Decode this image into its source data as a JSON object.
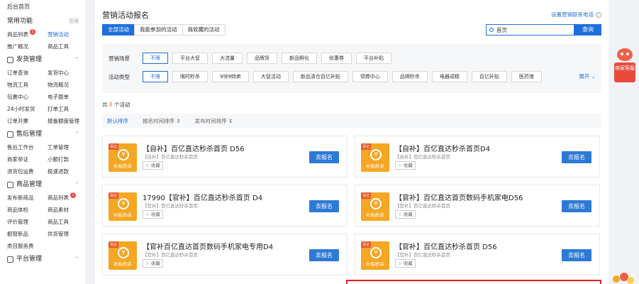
{
  "sidebar": {
    "top_link": "后台首页",
    "sections": [
      {
        "title": "常用功能",
        "right": "管理",
        "items": [
          {
            "label": "商品列表",
            "badge": "1"
          },
          {
            "label": "营销活动",
            "active": true
          },
          {
            "label": "推广概况"
          },
          {
            "label": "商品工具"
          }
        ]
      },
      {
        "title": "发货管理",
        "right": "^",
        "items": [
          {
            "label": "订单查询"
          },
          {
            "label": "发货中心"
          },
          {
            "label": "物流工具"
          },
          {
            "label": "物流概况"
          },
          {
            "label": "包裹中心"
          },
          {
            "label": "电子面单"
          },
          {
            "label": "24小时发货"
          },
          {
            "label": "打单工具"
          },
          {
            "label": "订单开票"
          },
          {
            "label": "报备额度管理"
          }
        ]
      },
      {
        "title": "售后管理",
        "right": "^",
        "items": [
          {
            "label": "售后工作台"
          },
          {
            "label": "工单管理"
          },
          {
            "label": "商家举证"
          },
          {
            "label": "小额打款"
          },
          {
            "label": "退货包运费"
          },
          {
            "label": "极速退款"
          }
        ]
      },
      {
        "title": "商品管理",
        "right": "^",
        "items": [
          {
            "label": "发布新商品"
          },
          {
            "label": "商品列表",
            "badge": "1"
          },
          {
            "label": "商品体检"
          },
          {
            "label": "商品素材"
          },
          {
            "label": "评价管理"
          },
          {
            "label": "商品工具"
          },
          {
            "label": "橱窗新品"
          },
          {
            "label": "供货管理"
          },
          {
            "label": "类目服务费"
          }
        ]
      },
      {
        "title": "平台管理",
        "right": "^",
        "items": []
      }
    ]
  },
  "header": {
    "title": "营销活动报名",
    "contact": "设置营销联系电话",
    "help_icon": "?"
  },
  "tabs": [
    "全部活动",
    "我能参加的活动",
    "我收藏的活动"
  ],
  "search": {
    "value": "首页",
    "button": "查询"
  },
  "filters": {
    "scene_label": "营销场景",
    "scene_chips": [
      "不限",
      "平台大促",
      "大流量",
      "品牌货",
      "新品孵化",
      "优惠券",
      "平台补贴"
    ],
    "type_label": "活动类型",
    "type_chips": [
      "不限",
      "限时秒杀",
      "9块9特卖",
      "大促活动",
      "新品清仓百亿补贴",
      "领券中心",
      "品牌秒杀",
      "电器成精",
      "百亿补贴",
      "医药馆"
    ],
    "expand": "展开 ⌄"
  },
  "count": {
    "prefix": "共 ",
    "num": "8",
    "suffix": " 个活动"
  },
  "sorts": [
    "默认排序",
    "报名时间排序 ⇕",
    "发布时间排序 ⇕"
  ],
  "cards": [
    {
      "title": "【自补】百亿直达秒杀首页 D56",
      "sub": "【自补】百亿直达秒杀首页",
      "fav": "☆ 收藏",
      "tag": "百亿",
      "thumb": "补贴秒杀",
      "btn": "去报名"
    },
    {
      "title": "【自补】百亿直达秒杀首页D4",
      "sub": "【自补】百亿直达秒杀首页",
      "fav": "☆ 收藏",
      "tag": "百亿",
      "thumb": "补贴秒杀",
      "btn": "去报名"
    },
    {
      "title": "17990【官补】百亿直达秒杀首页 D4",
      "sub": "【官补】百亿直达秒杀首页",
      "fav": "☆ 收藏",
      "tag": "百亿",
      "thumb": "补贴秒杀",
      "btn": "去报名"
    },
    {
      "title": "【官补】百亿直达首页数码手机家电D56",
      "sub": "【官补】百亿直达秒杀首页",
      "fav": "☆ 收藏",
      "tag": "百亿",
      "thumb": "补贴秒杀",
      "btn": "去报名"
    },
    {
      "title": "【官补百亿直达首页数码手机家电专用D4",
      "sub": "【官补】百亿直达秒杀首页",
      "fav": "☆ 收藏",
      "tag": "百亿",
      "thumb": "补贴秒杀",
      "btn": "去报名"
    },
    {
      "title": "【官补】百亿直达秒杀首页 D56",
      "sub": "【官补】百亿直达秒杀首页",
      "fav": "☆ 收藏",
      "tag": "百亿",
      "thumb": "补贴秒杀",
      "btn": "去报名"
    }
  ],
  "service": {
    "label": "商家客服"
  },
  "colors": {
    "accent": "#1e6fdc",
    "badge": "#f04848",
    "thumb": "#f5a623",
    "count": "#f0842a"
  }
}
